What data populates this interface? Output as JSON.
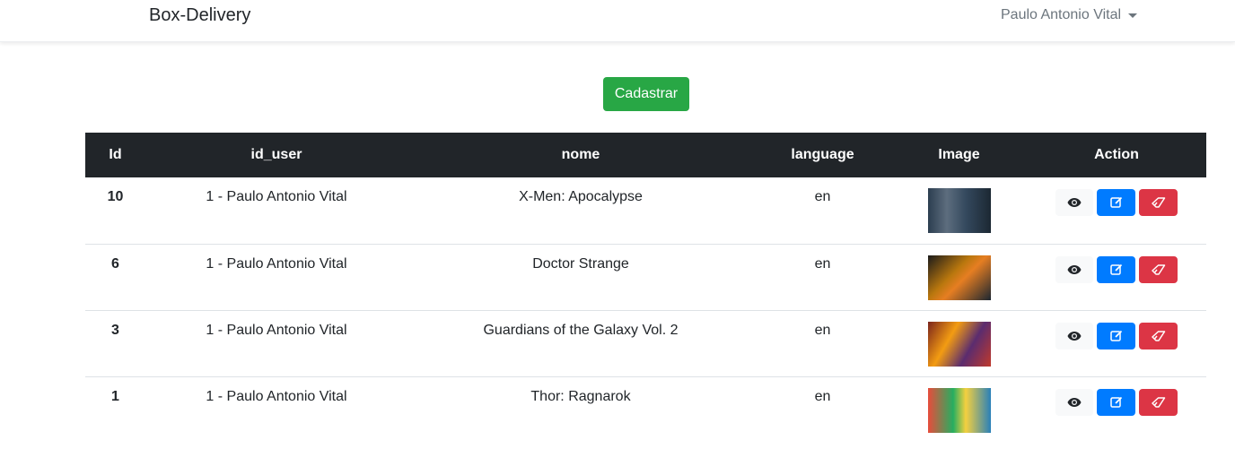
{
  "navbar": {
    "brand": "Box-Delivery",
    "user_name": "Paulo Antonio Vital"
  },
  "main": {
    "create_button_label": "Cadastrar"
  },
  "table": {
    "headers": [
      "Id",
      "id_user",
      "nome",
      "language",
      "Image",
      "Action"
    ],
    "rows": [
      {
        "id": "10",
        "id_user": "1 - Paulo Antonio Vital",
        "nome": "X-Men: Apocalypse",
        "language": "en",
        "image": "poster-thumbnail"
      },
      {
        "id": "6",
        "id_user": "1 - Paulo Antonio Vital",
        "nome": "Doctor Strange",
        "language": "en",
        "image": "poster-thumbnail"
      },
      {
        "id": "3",
        "id_user": "1 - Paulo Antonio Vital",
        "nome": "Guardians of the Galaxy Vol. 2",
        "language": "en",
        "image": "poster-thumbnail"
      },
      {
        "id": "1",
        "id_user": "1 - Paulo Antonio Vital",
        "nome": "Thor: Ragnarok",
        "language": "en",
        "image": "poster-thumbnail"
      }
    ],
    "action_icons": {
      "view": "eye-icon",
      "edit": "edit-icon",
      "delete": "eraser-icon"
    }
  },
  "colors": {
    "success": "#28a745",
    "primary": "#007bff",
    "danger": "#dc3545",
    "dark": "#212529",
    "light": "#f8f9fa"
  }
}
